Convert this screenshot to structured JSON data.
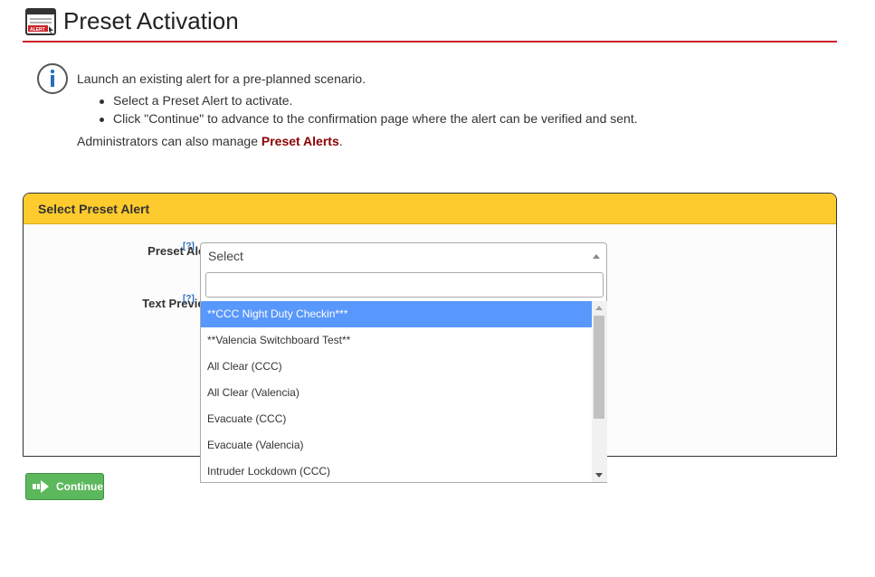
{
  "header": {
    "title": "Preset Activation",
    "icon": "alert-window-icon",
    "icon_text": "ALERT",
    "accent_color": "#cc2229"
  },
  "info": {
    "icon": "info-icon",
    "intro": "Launch an existing alert for a pre-planned scenario.",
    "bullets": [
      "Select a Preset Alert to activate.",
      "Click \"Continue\" to advance to the confirmation page where the alert can be verified and sent."
    ],
    "admin_prefix": "Administrators can also manage ",
    "admin_link": "Preset Alerts",
    "admin_suffix": "."
  },
  "panel": {
    "title": "Select Preset Alert",
    "header_color": "#fecb2e",
    "preset_label": "Preset Alert:",
    "preview_label": "Text Preview:",
    "help_text": "[?]"
  },
  "select": {
    "value": "Select",
    "search_placeholder": "",
    "options": [
      "**CCC Night Duty Checkin***",
      "**Valencia Switchboard Test**",
      "All Clear (CCC)",
      "All Clear (Valencia)",
      "Evacuate (CCC)",
      "Evacuate (Valencia)",
      "Intruder Lockdown (CCC)"
    ],
    "highlighted_index": 0,
    "highlight_color": "#5897fb"
  },
  "actions": {
    "continue_label": "Continue",
    "continue_color": "#5cb85c"
  }
}
